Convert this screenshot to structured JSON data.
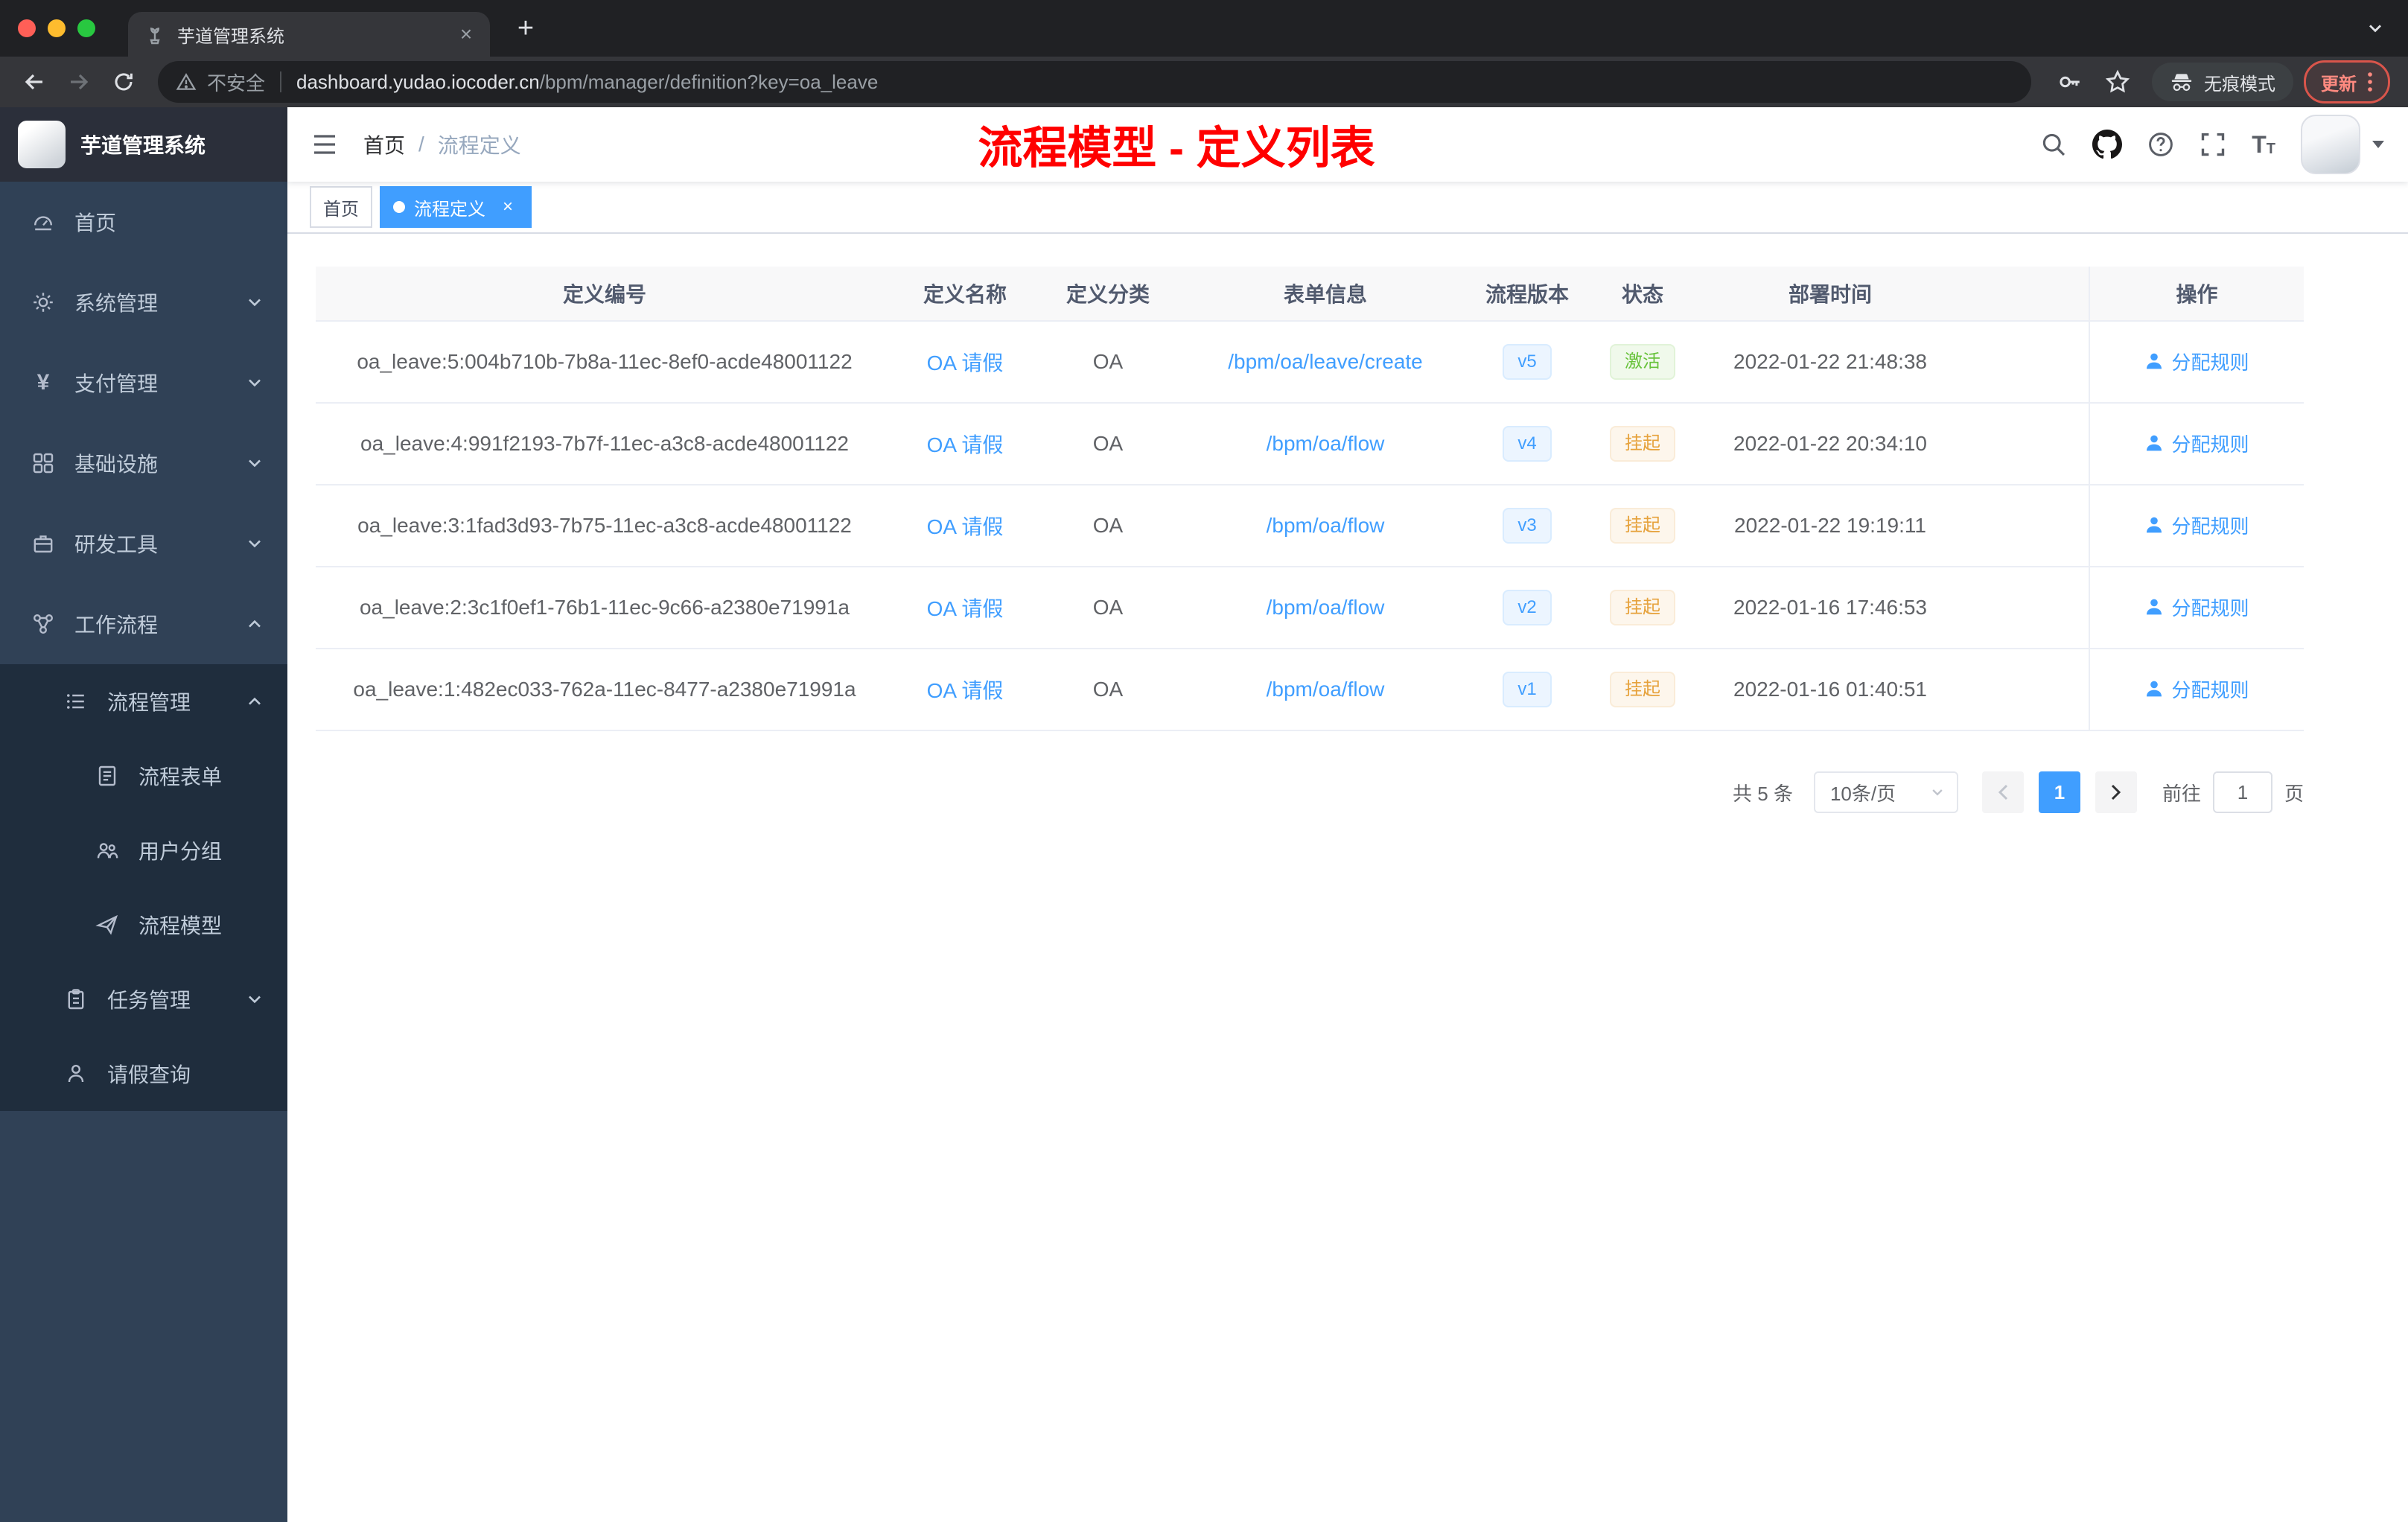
{
  "browser": {
    "tab_title": "芋道管理系统",
    "address": {
      "security": "不安全",
      "host": "dashboard.yudao.iocoder.cn",
      "path": "/bpm/manager/definition?key=oa_leave"
    },
    "incognito_label": "无痕模式",
    "update_label": "更新"
  },
  "sidebar": {
    "logo_title": "芋道管理系统",
    "items": [
      {
        "label": "首页"
      },
      {
        "label": "系统管理"
      },
      {
        "label": "支付管理"
      },
      {
        "label": "基础设施"
      },
      {
        "label": "研发工具"
      },
      {
        "label": "工作流程"
      },
      {
        "label": "流程管理"
      },
      {
        "label": "流程表单"
      },
      {
        "label": "用户分组"
      },
      {
        "label": "流程模型"
      },
      {
        "label": "任务管理"
      },
      {
        "label": "请假查询"
      }
    ],
    "pay_icon_glyph": "¥"
  },
  "navbar": {
    "breadcrumb_home": "首页",
    "breadcrumb_sep": "/",
    "breadcrumb_current": "流程定义",
    "annotation": "流程模型 - 定义列表"
  },
  "tags": {
    "home": "首页",
    "active": "流程定义"
  },
  "table": {
    "columns": {
      "id": "定义编号",
      "name": "定义名称",
      "category": "定义分类",
      "form": "表单信息",
      "version": "流程版本",
      "status": "状态",
      "deployed": "部署时间",
      "action": "操作"
    },
    "rows": [
      {
        "id": "oa_leave:5:004b710b-7b8a-11ec-8ef0-acde48001122",
        "name": "OA 请假",
        "category": "OA",
        "form": "/bpm/oa/leave/create",
        "version": "v5",
        "status": "激活",
        "deployed": "2022-01-22 21:48:38",
        "action": "分配规则"
      },
      {
        "id": "oa_leave:4:991f2193-7b7f-11ec-a3c8-acde48001122",
        "name": "OA 请假",
        "category": "OA",
        "form": "/bpm/oa/flow",
        "version": "v4",
        "status": "挂起",
        "deployed": "2022-01-22 20:34:10",
        "action": "分配规则"
      },
      {
        "id": "oa_leave:3:1fad3d93-7b75-11ec-a3c8-acde48001122",
        "name": "OA 请假",
        "category": "OA",
        "form": "/bpm/oa/flow",
        "version": "v3",
        "status": "挂起",
        "deployed": "2022-01-22 19:19:11",
        "action": "分配规则"
      },
      {
        "id": "oa_leave:2:3c1f0ef1-76b1-11ec-9c66-a2380e71991a",
        "name": "OA 请假",
        "category": "OA",
        "form": "/bpm/oa/flow",
        "version": "v2",
        "status": "挂起",
        "deployed": "2022-01-16 17:46:53",
        "action": "分配规则"
      },
      {
        "id": "oa_leave:1:482ec033-762a-11ec-8477-a2380e71991a",
        "name": "OA 请假",
        "category": "OA",
        "form": "/bpm/oa/flow",
        "version": "v1",
        "status": "挂起",
        "deployed": "2022-01-16 01:40:51",
        "action": "分配规则"
      }
    ]
  },
  "pagination": {
    "total": "共 5 条",
    "page_size": "10条/页",
    "current_page": "1",
    "goto_label": "前往",
    "page_unit": "页",
    "jumper": "1"
  },
  "colors": {
    "accent": "#409eff",
    "status_active": "#67c23a",
    "status_suspended": "#e6a23c",
    "annotation": "#ff0000",
    "sidebar_bg": "#304156"
  }
}
